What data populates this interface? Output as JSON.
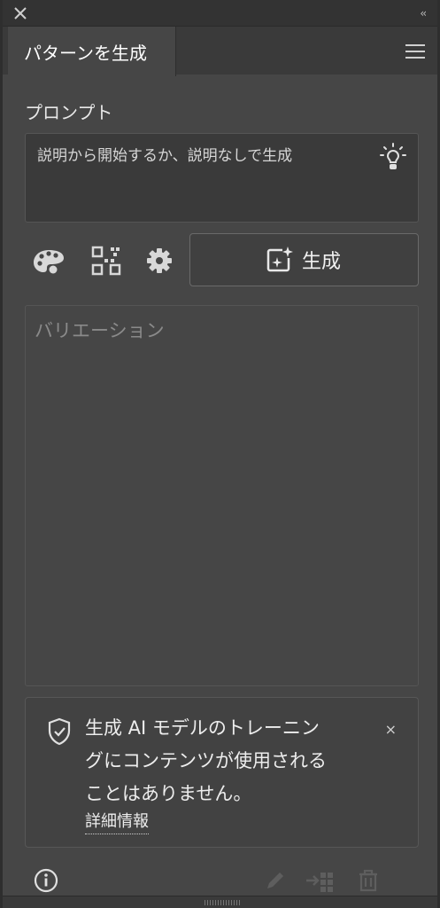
{
  "titlebar": {
    "close_icon": "close-icon",
    "collapse_label": "‹‹"
  },
  "tab": {
    "label": "パターンを生成",
    "menu_icon": "hamburger-menu-icon"
  },
  "prompt": {
    "label": "プロンプト",
    "placeholder": "説明から開始するか、説明なしで生成",
    "suggest_icon": "lightbulb-icon"
  },
  "toolbar": {
    "color_icon": "palette-icon",
    "pattern_icon": "pattern-grid-icon",
    "settings_icon": "gear-icon",
    "generate_label": "生成",
    "generate_icon": "sparkle-generate-icon"
  },
  "variations": {
    "placeholder": "バリエーション"
  },
  "notice": {
    "icon": "shield-icon",
    "line1": "生成 AI モデルのトレーニン",
    "line2": "グにコンテンツが使用される",
    "line3": "ことはありません。",
    "link": "詳細情報",
    "close_label": "×"
  },
  "footer": {
    "info_icon": "info-icon",
    "edit_icon": "pencil-icon",
    "apply_icon": "apply-to-swatches-icon",
    "delete_icon": "trash-icon"
  },
  "colors": {
    "panel_bg": "#464646",
    "titlebar_bg": "#333333",
    "text": "#e6e6e6",
    "muted": "#8a8a8a"
  }
}
